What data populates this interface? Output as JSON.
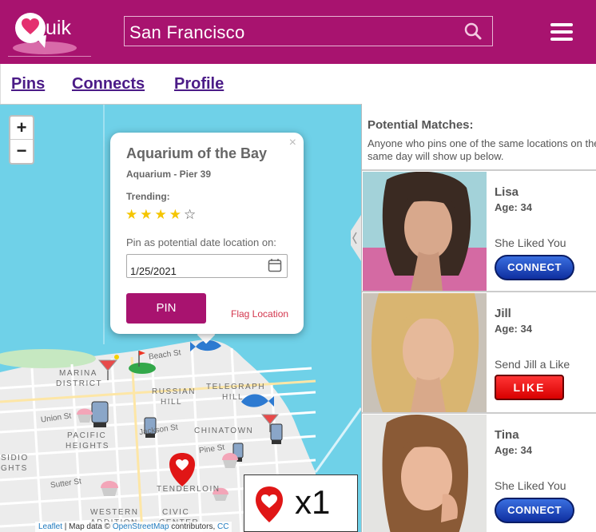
{
  "header": {
    "logo_text": "uik",
    "search_value": "San Francisco",
    "search_icon": "search-icon",
    "menu_icon": "hamburger-menu-icon",
    "brand_color": "#a8136f"
  },
  "nav": {
    "items": [
      {
        "label": "Pins"
      },
      {
        "label": "Connects"
      },
      {
        "label": "Profile"
      }
    ],
    "color": "#4b1b87"
  },
  "map": {
    "zoom_in": "+",
    "zoom_out": "−",
    "popup": {
      "close": "×",
      "title": "Aquarium of the Bay",
      "subtitle": "Aquarium - Pier 39",
      "trending_label": "Trending:",
      "rating": 4,
      "rating_max": 5,
      "pin_label": "Pin as potential date location on:",
      "date_value": "1/25/2021",
      "pin_button": "PIN",
      "flag_link": "Flag Location"
    },
    "district_labels": {
      "marina": "MARINA",
      "district": "DISTRICT",
      "russian": "RUSSIAN",
      "hill": "HILL",
      "telegraph": "TELEGRAPH",
      "telegraph_hill": "HILL",
      "chinatown": "CHINATOWN",
      "pacific": "PACIFIC",
      "heights": "HEIGHTS",
      "tenderloin": "TENDERLOIN",
      "western": "WESTERN",
      "addition": "ADDITION",
      "civic": "CIVIC",
      "center": "CENTER",
      "sidio": "SIDIO",
      "ghts": "GHTS"
    },
    "street_labels": {
      "beach": "Beach St",
      "union": "Union St",
      "jackson": "Jackson St",
      "pine": "Pine St",
      "sutter": "Sutter St"
    },
    "attribution": {
      "leaflet": "Leaflet",
      "sep": " | Map data © ",
      "osm": "OpenStreetMap",
      "contrib": " contributors, ",
      "cc": "CC"
    },
    "pin_count": "x1",
    "pin_icon": "heart-pin-icon"
  },
  "matches": {
    "title": "Potential Matches:",
    "description": "Anyone who pins one of the same locations on the same day will show up below.",
    "people": [
      {
        "name": "Lisa",
        "age": "Age: 34",
        "status": "She Liked You",
        "action": "CONNECT"
      },
      {
        "name": "Jill",
        "age": "Age: 34",
        "status": "Send Jill a Like",
        "action": "LIKE"
      },
      {
        "name": "Tina",
        "age": "Age: 34",
        "status": "She Liked You",
        "action": "CONNECT"
      }
    ]
  }
}
